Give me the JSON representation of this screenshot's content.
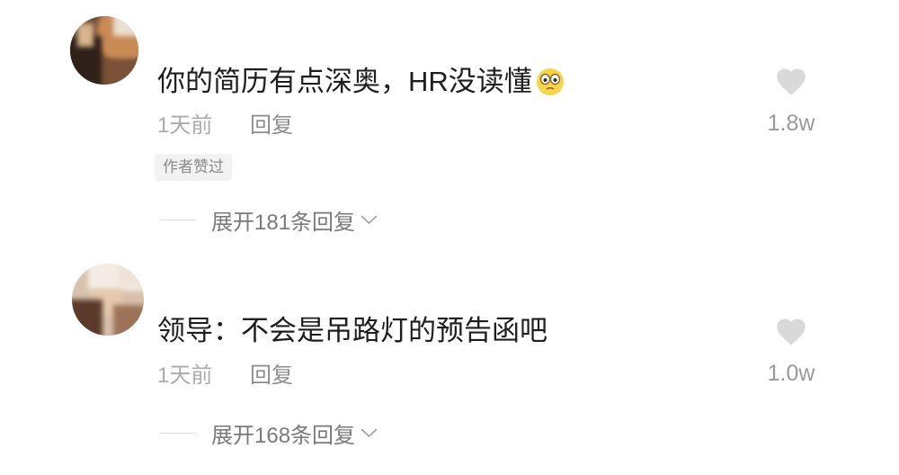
{
  "comments": [
    {
      "text": "你的简历有点深奥，HR没读懂",
      "emoji_icon": "face-emoji-icon",
      "time": "1天前",
      "reply_label": "回复",
      "badge": "作者赞过",
      "likes": "1.8w",
      "expand_label": "展开181条回复"
    },
    {
      "text": "领导：不会是吊路灯的预告函吧",
      "time": "1天前",
      "reply_label": "回复",
      "likes": "1.0w",
      "expand_label": "展开168条回复"
    }
  ],
  "icons": {
    "like": "heart-icon",
    "expand": "chevron-down-icon"
  },
  "colors": {
    "text": "#1e1e1e",
    "meta": "#ababab",
    "reply": "#8c8c8c",
    "expand": "#7a7a7a",
    "likes": "#9a9a9a",
    "badge_bg": "#f2f2f2",
    "heart": "#d9d9d9"
  }
}
